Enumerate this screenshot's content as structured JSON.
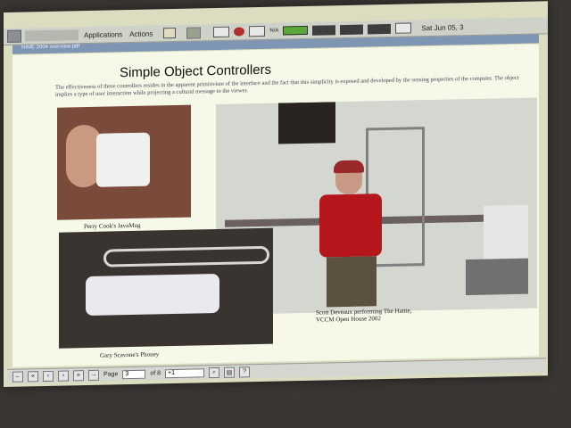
{
  "top_panel": {
    "menu": [
      "Applications",
      "Actions"
    ],
    "tray_na": "N/A",
    "clock": "Sat Jun 05, 3"
  },
  "tab": {
    "title": "NIME 2004 overview.pdf"
  },
  "slide": {
    "title": "Simple Object Controllers",
    "body": "The effectiveness of these controllers resides in the apparent primitivism of the interface and the fact that this simplicity is exposed and developed by the sensing properties of the computer. The object implies a type of user interaction while projecting a cultural message to the viewer.",
    "captions": {
      "mug": "Perry Cook's JavaMug",
      "performance_line1": "Scott Deveaux performing The Hattie,",
      "performance_line2": "VCCM Open House 2002",
      "phone": "Gary Scavone's Phoney"
    }
  },
  "status_bar": {
    "page_label": "Page",
    "page_value": "3",
    "of_label": "of 8",
    "zoom_value": "+1"
  }
}
